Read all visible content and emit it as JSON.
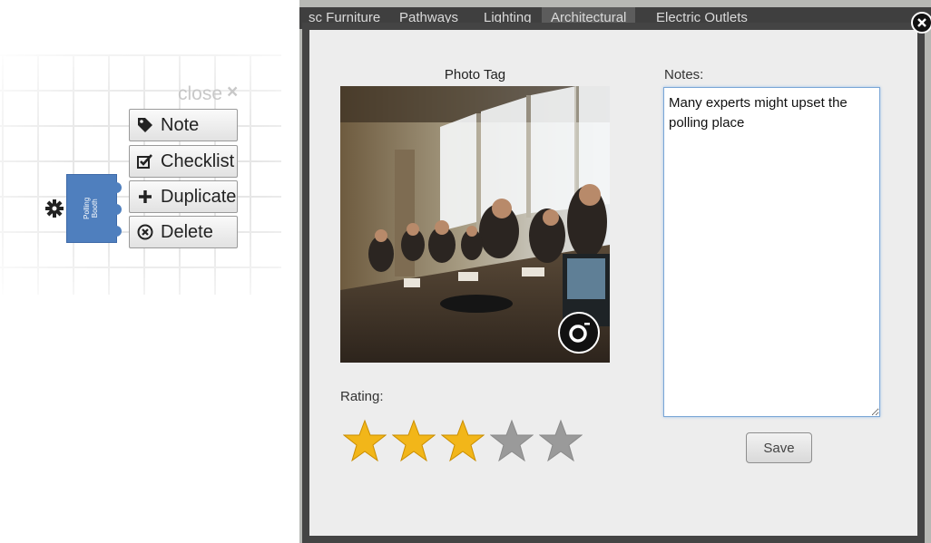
{
  "context_menu": {
    "close_label": "close",
    "close_x": "×",
    "items": [
      {
        "label": "Note",
        "icon": "tag-icon"
      },
      {
        "label": "Checklist",
        "icon": "checkbox-icon"
      },
      {
        "label": "Duplicate",
        "icon": "plus-icon"
      },
      {
        "label": "Delete",
        "icon": "x-circle-icon"
      }
    ],
    "booth_label_line1": "Polling",
    "booth_label_line2": "Booth",
    "booth_color": "#4f7fbe"
  },
  "top_tabs": [
    "sc Furniture",
    "Pathways",
    "Lighting",
    "Architectural",
    "Electric Outlets"
  ],
  "active_tab": "Architectural",
  "dialog": {
    "photo_title": "Photo Tag",
    "notes_label": "Notes:",
    "notes_value": "Many experts might upset the polling place",
    "rating_label": "Rating:",
    "rating": 3,
    "rating_max": 5,
    "save_label": "Save",
    "star_on_color": "#f2b619",
    "star_off_color": "#9a9a9a"
  }
}
